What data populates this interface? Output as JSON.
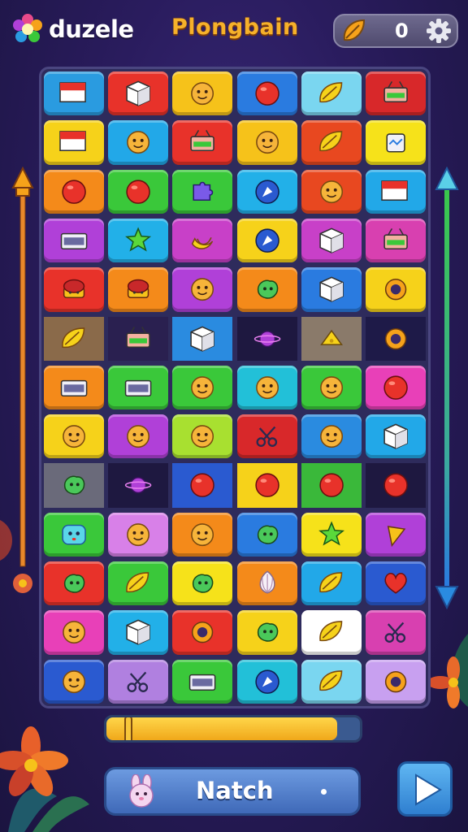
{
  "header": {
    "logo_text": "duzele",
    "game_title": "Plongbain",
    "score": "0"
  },
  "board": {
    "cols": 6,
    "rows": [
      [
        {
          "bg": "#2a9be0",
          "icon": "flag-icon"
        },
        {
          "bg": "#e8322a",
          "icon": "box-icon"
        },
        {
          "bg": "#f6c21a",
          "icon": "smiley-icon"
        },
        {
          "bg": "#2a7be0",
          "icon": "ball-icon"
        },
        {
          "bg": "#7ad6f0",
          "icon": "leaf-icon"
        },
        {
          "bg": "#d8282a",
          "icon": "basket-icon"
        }
      ],
      [
        {
          "bg": "#f6d21a",
          "icon": "flag-icon"
        },
        {
          "bg": "#22a8e8",
          "icon": "smiley-icon"
        },
        {
          "bg": "#e8322a",
          "icon": "basket-icon"
        },
        {
          "bg": "#f6c21a",
          "icon": "smiley-icon"
        },
        {
          "bg": "#e84820",
          "icon": "leaf-icon"
        },
        {
          "bg": "#f6e21a",
          "icon": "jar-icon"
        }
      ],
      [
        {
          "bg": "#f48a1a",
          "icon": "ball-icon"
        },
        {
          "bg": "#3ac83a",
          "icon": "ball-icon"
        },
        {
          "bg": "#3ac83a",
          "icon": "puzzle-icon"
        },
        {
          "bg": "#22b0e8",
          "icon": "compass-icon"
        },
        {
          "bg": "#e84820",
          "icon": "smiley-icon"
        },
        {
          "bg": "#22a8e8",
          "icon": "flag-icon"
        }
      ],
      [
        {
          "bg": "#b040d8",
          "icon": "card-icon"
        },
        {
          "bg": "#22b0e8",
          "icon": "star-icon"
        },
        {
          "bg": "#c840c8",
          "icon": "banana-icon"
        },
        {
          "bg": "#f6d21a",
          "icon": "compass-icon"
        },
        {
          "bg": "#c840c8",
          "icon": "box-icon"
        },
        {
          "bg": "#d840b0",
          "icon": "basket-icon"
        }
      ],
      [
        {
          "bg": "#e8322a",
          "icon": "cake-icon"
        },
        {
          "bg": "#f48a1a",
          "icon": "cake-icon"
        },
        {
          "bg": "#b040d8",
          "icon": "smiley-icon"
        },
        {
          "bg": "#f48a1a",
          "icon": "blob-icon"
        },
        {
          "bg": "#2a7be0",
          "icon": "box-icon"
        },
        {
          "bg": "#f6d21a",
          "icon": "ring-icon"
        }
      ],
      [
        {
          "bg": "#8a6a4a",
          "icon": "leaf-icon",
          "flat": true
        },
        {
          "bg": "#2a2050",
          "icon": "basket-icon",
          "flat": true
        },
        {
          "bg": "#2a8be0",
          "icon": "box-icon",
          "flat": true
        },
        {
          "bg": "#1e1840",
          "icon": "planet-icon",
          "flat": true
        },
        {
          "bg": "#8a7a6a",
          "icon": "cheese-icon",
          "flat": true
        },
        {
          "bg": "#1e1a48",
          "icon": "ring-icon",
          "flat": true
        }
      ],
      [
        {
          "bg": "#f48a1a",
          "icon": "card-icon"
        },
        {
          "bg": "#3ac83a",
          "icon": "card-icon"
        },
        {
          "bg": "#3ac83a",
          "icon": "smiley-icon"
        },
        {
          "bg": "#22c0d8",
          "icon": "smiley-icon"
        },
        {
          "bg": "#3ac83a",
          "icon": "smiley-icon"
        },
        {
          "bg": "#e840b8",
          "icon": "ball-icon"
        }
      ],
      [
        {
          "bg": "#f6d21a",
          "icon": "smiley-icon"
        },
        {
          "bg": "#b040d8",
          "icon": "smiley-icon"
        },
        {
          "bg": "#a8e030",
          "icon": "smiley-icon"
        },
        {
          "bg": "#d8282a",
          "icon": "scissors-icon"
        },
        {
          "bg": "#2a8be0",
          "icon": "smiley-icon"
        },
        {
          "bg": "#22a8e8",
          "icon": "box-icon"
        }
      ],
      [
        {
          "bg": "#6a6a7a",
          "icon": "blob-icon",
          "flat": true
        },
        {
          "bg": "#1e1840",
          "icon": "planet-icon",
          "flat": true
        },
        {
          "bg": "#2a5ad0",
          "icon": "ball-icon",
          "flat": true
        },
        {
          "bg": "#f6d21a",
          "icon": "ball-icon",
          "flat": true
        },
        {
          "bg": "#3ab83a",
          "icon": "ball-icon",
          "flat": true
        },
        {
          "bg": "#1e1840",
          "icon": "ball-icon",
          "flat": true
        }
      ],
      [
        {
          "bg": "#3ac83a",
          "icon": "face-icon"
        },
        {
          "bg": "#d880e8",
          "icon": "smiley-icon"
        },
        {
          "bg": "#f48a1a",
          "icon": "smiley-icon"
        },
        {
          "bg": "#2a7be0",
          "icon": "blob-icon"
        },
        {
          "bg": "#f6e21a",
          "icon": "star-icon"
        },
        {
          "bg": "#b040d8",
          "icon": "cone-icon"
        }
      ],
      [
        {
          "bg": "#e8322a",
          "icon": "blob-icon"
        },
        {
          "bg": "#3ac83a",
          "icon": "leaf-icon"
        },
        {
          "bg": "#f6e21a",
          "icon": "blob-icon"
        },
        {
          "bg": "#f48a1a",
          "icon": "garlic-icon"
        },
        {
          "bg": "#22a8e8",
          "icon": "leaf-icon"
        },
        {
          "bg": "#2a5ad0",
          "icon": "heart-icon"
        }
      ],
      [
        {
          "bg": "#e840b8",
          "icon": "smiley-icon"
        },
        {
          "bg": "#22b0e8",
          "icon": "box-icon"
        },
        {
          "bg": "#e8322a",
          "icon": "ring-icon"
        },
        {
          "bg": "#f6d21a",
          "icon": "blob-icon"
        },
        {
          "bg": "#ffffff",
          "icon": "leaf-icon"
        },
        {
          "bg": "#d840b0",
          "icon": "scissors-icon"
        }
      ],
      [
        {
          "bg": "#2a5ad0",
          "icon": "smiley-icon"
        },
        {
          "bg": "#b080e0",
          "icon": "scissors-icon"
        },
        {
          "bg": "#3ac83a",
          "icon": "card-icon"
        },
        {
          "bg": "#22c0d8",
          "icon": "compass-icon"
        },
        {
          "bg": "#7ad6f0",
          "icon": "leaf-icon"
        },
        {
          "bg": "#c8a0f0",
          "icon": "ring-icon"
        }
      ]
    ]
  },
  "progress": {
    "value": 0.91
  },
  "footer": {
    "match_label": "Natch"
  },
  "colors": {
    "accent": "#f6b12a",
    "button": "#4f7fcc",
    "progress": "#f7c63a"
  }
}
